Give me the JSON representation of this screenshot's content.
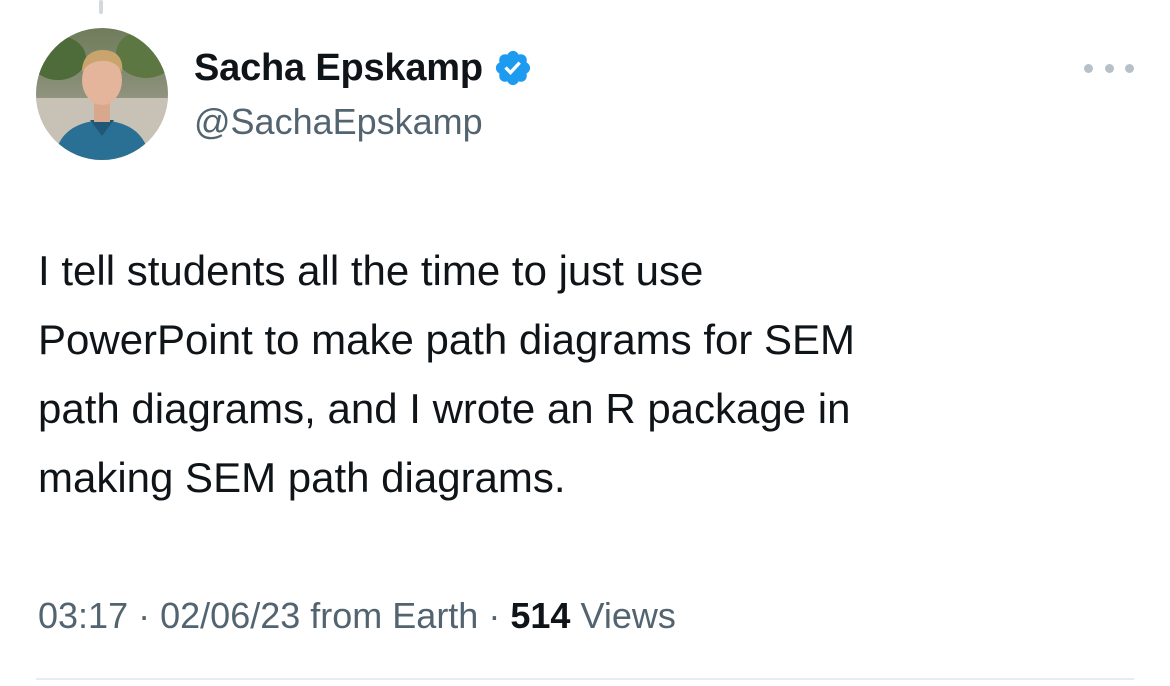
{
  "author": {
    "display_name": "Sacha Epskamp",
    "handle": "@SachaEpskamp",
    "verified": true,
    "avatar_icon": "profile-photo"
  },
  "tweet": {
    "lines": [
      "I tell students all the time to just use",
      "PowerPoint to make path diagrams for SEM",
      "path diagrams, and I wrote an R package in",
      "making SEM path diagrams."
    ]
  },
  "meta": {
    "time": "03:17",
    "separator": "·",
    "date": "02/06/23",
    "source": "from Earth",
    "views_count": "514",
    "views_label": "Views"
  },
  "icons": {
    "verified": "verified-badge-icon",
    "more": "more-options-icon"
  },
  "colors": {
    "verified_blue": "#1d9bf0",
    "text_primary": "#0f1419",
    "text_secondary": "#536471",
    "divider": "#e6ecf0"
  }
}
